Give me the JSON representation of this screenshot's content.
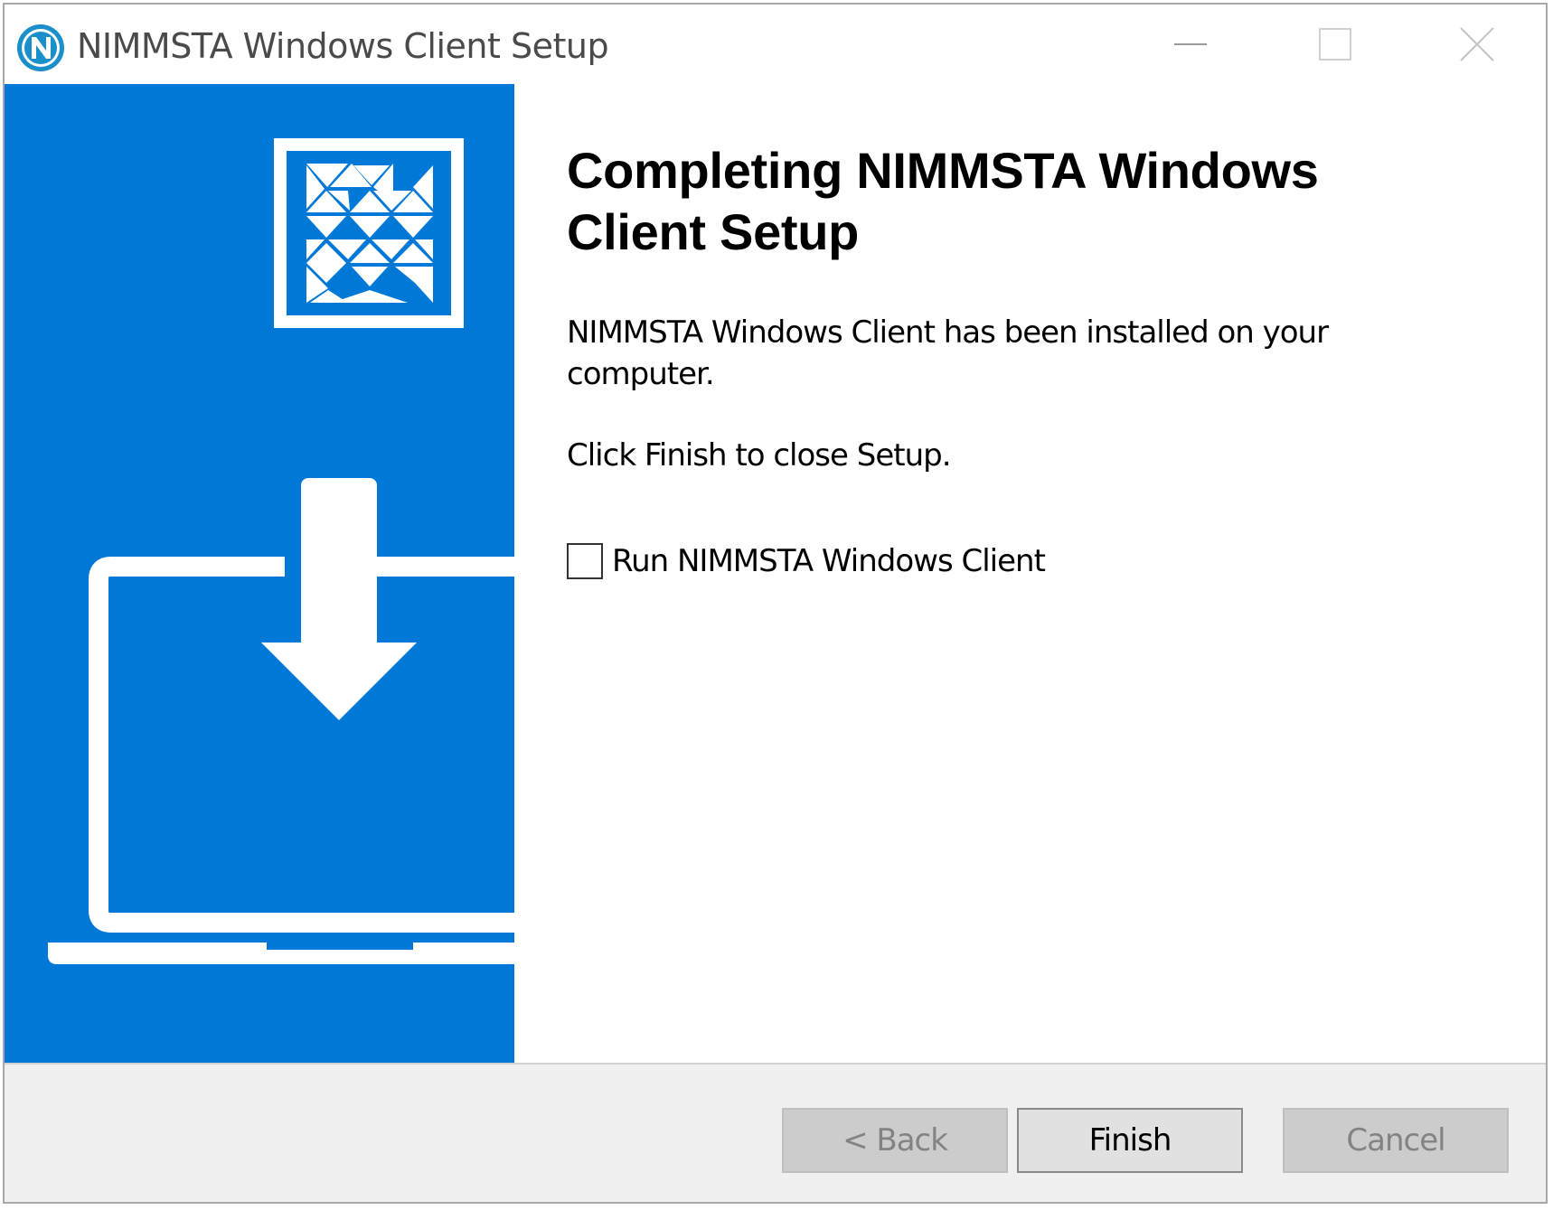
{
  "window": {
    "title": "NIMMSTA Windows Client Setup",
    "icon": "nimmsta-n-logo-icon"
  },
  "caption_buttons": {
    "minimize_icon": "minimize-icon",
    "maximize_icon": "maximize-icon",
    "close_icon": "close-icon"
  },
  "side_panel": {
    "background_color": "#0078d7",
    "logo_icon": "nimmsta-triangle-logo-icon",
    "illustration_icon": "laptop-download-icon"
  },
  "main": {
    "heading": "Completing NIMMSTA Windows Client Setup",
    "description": "NIMMSTA Windows Client has been installed on your computer.",
    "hint": "Click Finish to close Setup.",
    "run_option": {
      "label": "Run NIMMSTA Windows Client",
      "checked": false
    }
  },
  "footer": {
    "back_label": "< Back",
    "finish_label": "Finish",
    "cancel_label": "Cancel"
  }
}
